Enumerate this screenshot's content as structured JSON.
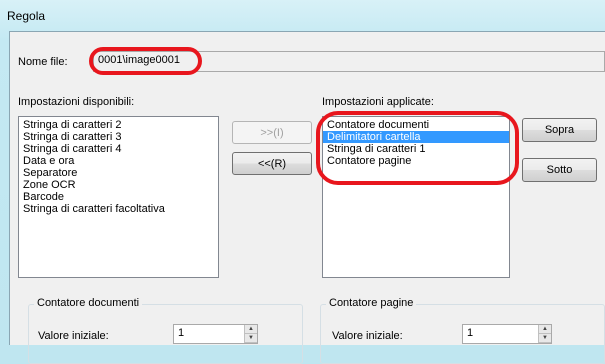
{
  "window": {
    "title": "Regola"
  },
  "file": {
    "label": "Nome file:",
    "value": "0001\\image0001"
  },
  "available": {
    "label": "Impostazioni disponibili:",
    "items": [
      "Stringa di caratteri 2",
      "Stringa di caratteri 3",
      "Stringa di caratteri 4",
      "Data e ora",
      "Separatore",
      "Zone OCR",
      "Barcode",
      "Stringa di caratteri facoltativa"
    ]
  },
  "applied": {
    "label": "Impostazioni applicate:",
    "items": [
      "Contatore documenti",
      "Delimitatori cartella",
      "Stringa di caratteri 1",
      "Contatore pagine"
    ],
    "selected_index": 1
  },
  "buttons": {
    "add": "&gt;&gt;(I)",
    "remove": "&lt;&lt;(R)",
    "up": "Sopra",
    "down": "Sotto"
  },
  "doc_counter": {
    "title": "Contatore documenti",
    "initial_label": "Valore iniziale:",
    "initial_value": "1"
  },
  "page_counter": {
    "title": "Contatore pagine",
    "initial_label": "Valore iniziale:",
    "initial_value": "1"
  },
  "colors": {
    "highlight": "#e8161d",
    "selection": "#3399ff"
  },
  "icons": {
    "spin_up": "spin-up-arrow-icon",
    "spin_down": "spin-down-arrow-icon"
  }
}
